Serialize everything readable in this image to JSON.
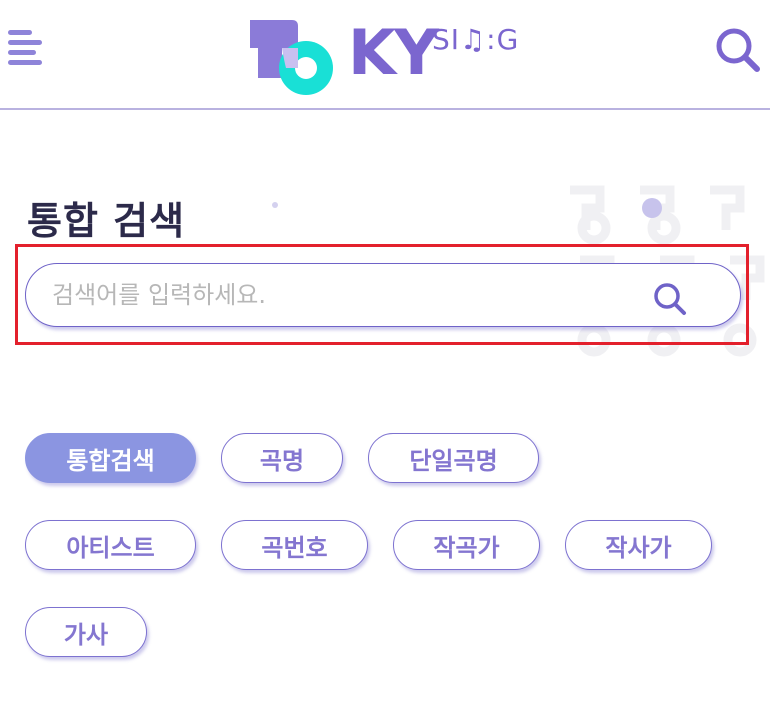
{
  "header": {
    "logo_text_main": "KY",
    "logo_text_sub": "SI♫:G",
    "icons": {
      "menu": "hamburger-menu-icon",
      "search": "search-icon"
    }
  },
  "page": {
    "title": "통합 검색"
  },
  "search": {
    "placeholder": "검색어를 입력하세요.",
    "value": ""
  },
  "filters": [
    {
      "label": "통합검색",
      "active": true
    },
    {
      "label": "곡명",
      "active": false
    },
    {
      "label": "단일곡명",
      "active": false
    },
    {
      "label": "아티스트",
      "active": false
    },
    {
      "label": "곡번호",
      "active": false
    },
    {
      "label": "작곡가",
      "active": false
    },
    {
      "label": "작사가",
      "active": false
    },
    {
      "label": "가사",
      "active": false
    }
  ],
  "colors": {
    "accent": "#7b66cf",
    "chip_active_bg": "#8b95e1",
    "chip_text": "#8476d0",
    "highlight": "#e3202c",
    "logo_teal": "#19e0d6"
  }
}
